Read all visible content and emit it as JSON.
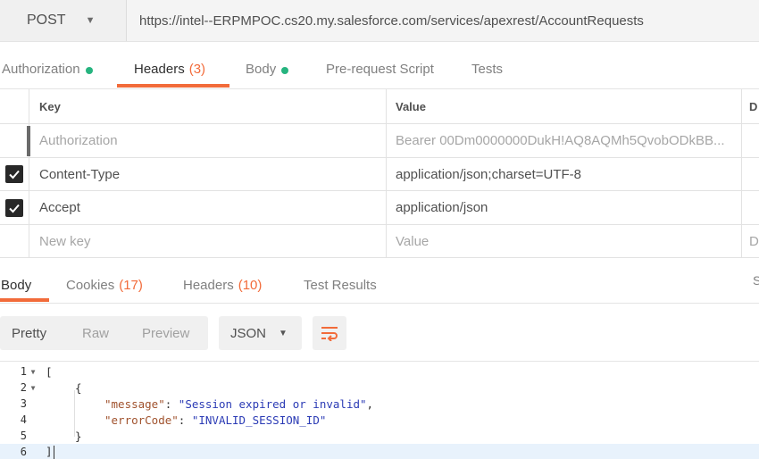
{
  "request": {
    "method": "POST",
    "url": "https://intel--ERPMPOC.cs20.my.salesforce.com/services/apexrest/AccountRequests"
  },
  "request_tabs": [
    {
      "label": "Authorization",
      "count": "",
      "has_dot": true,
      "active": false
    },
    {
      "label": "Headers",
      "count": "(3)",
      "has_dot": false,
      "active": true
    },
    {
      "label": "Body",
      "count": "",
      "has_dot": true,
      "active": false
    },
    {
      "label": "Pre-request Script",
      "count": "",
      "has_dot": false,
      "active": false
    },
    {
      "label": "Tests",
      "count": "",
      "has_dot": false,
      "active": false
    }
  ],
  "headers_table": {
    "columns": {
      "key": "Key",
      "value": "Value",
      "description": "D"
    },
    "rows": [
      {
        "checked": false,
        "disabled": true,
        "key": "Authorization",
        "value": "Bearer 00Dm0000000DukH!AQ8AQMh5QvobODkBB..."
      },
      {
        "checked": true,
        "disabled": false,
        "key": "Content-Type",
        "value": "application/json;charset=UTF-8"
      },
      {
        "checked": true,
        "disabled": false,
        "key": "Accept",
        "value": "application/json"
      }
    ],
    "new_row": {
      "key_placeholder": "New key",
      "value_placeholder": "Value",
      "description_placeholder": "D"
    }
  },
  "response_tabs": [
    {
      "label": "Body",
      "count": "",
      "active": true
    },
    {
      "label": "Cookies",
      "count": "(17)",
      "active": false
    },
    {
      "label": "Headers",
      "count": "(10)",
      "active": false
    },
    {
      "label": "Test Results",
      "count": "",
      "active": false
    }
  ],
  "response_tabs_right": "S",
  "view_modes": [
    "Pretty",
    "Raw",
    "Preview"
  ],
  "active_view_mode": "Pretty",
  "format": "JSON",
  "icons": {
    "method_dropdown": "chevron-down-icon",
    "format_dropdown": "chevron-down-icon",
    "wrap": "wrap-lines-icon",
    "check": "check-icon"
  },
  "colors": {
    "accent": "#f26b3a",
    "dot": "#26b47f",
    "checkbox": "#282828"
  },
  "code": {
    "lines": [
      {
        "n": "1",
        "fold": true
      },
      {
        "n": "2",
        "fold": true
      },
      {
        "n": "3",
        "fold": false
      },
      {
        "n": "4",
        "fold": false
      },
      {
        "n": "5",
        "fold": false
      },
      {
        "n": "6",
        "fold": false
      }
    ],
    "open_bracket": "[",
    "open_brace": "{",
    "message_key": "\"message\"",
    "message_value": "\"Session expired or invalid\"",
    "error_key": "\"errorCode\"",
    "error_value": "\"INVALID_SESSION_ID\"",
    "close_brace": "}",
    "close_bracket": "]"
  }
}
